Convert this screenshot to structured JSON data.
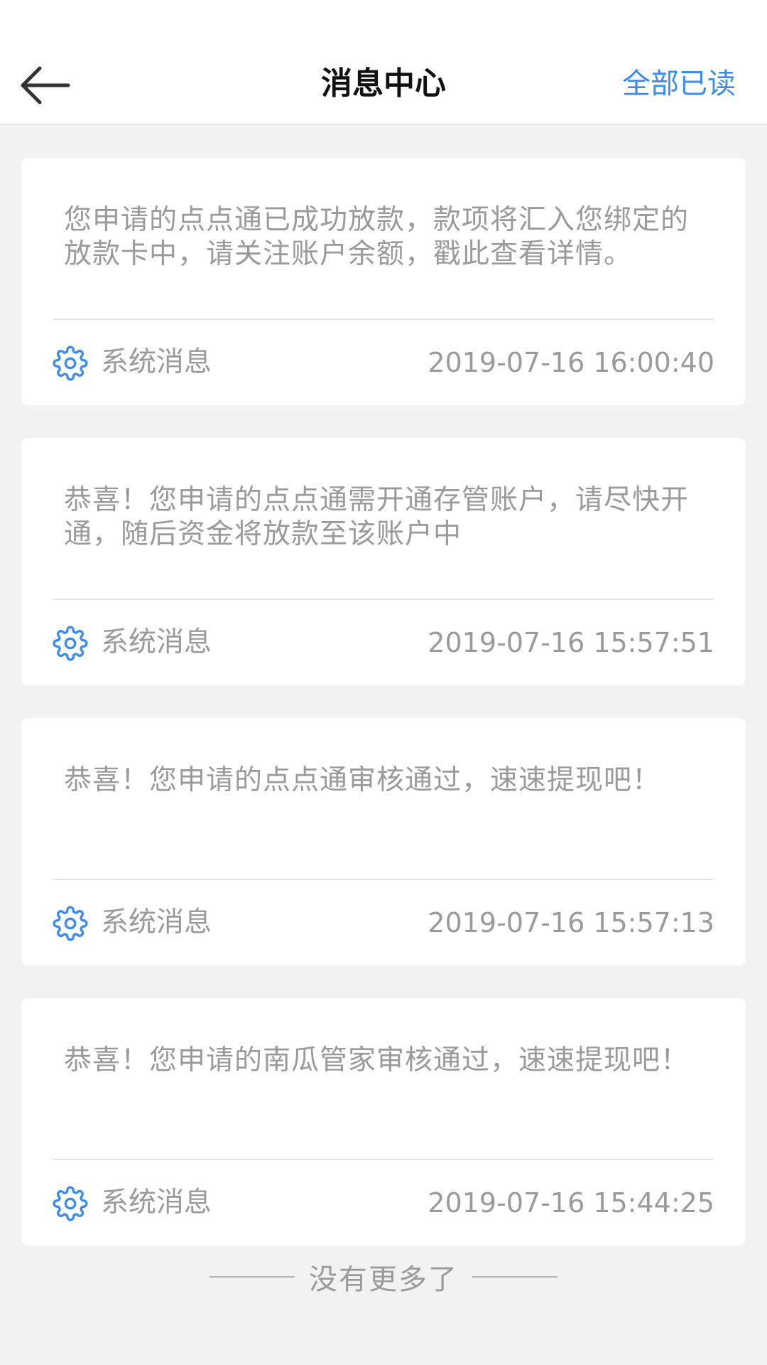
{
  "header": {
    "title": "消息中心",
    "read_all_label": "全部已读"
  },
  "messages": [
    {
      "text": "您申请的点点通已成功放款，款项将汇入您绑定的放款卡中，请关注账户余额，戳此查看详情。",
      "type": "系统消息",
      "time": "2019-07-16 16:00:40"
    },
    {
      "text": "恭喜！您申请的点点通需开通存管账户，请尽快开通，随后资金将放款至该账户中",
      "type": "系统消息",
      "time": "2019-07-16 15:57:51"
    },
    {
      "text": "恭喜！您申请的点点通审核通过，速速提现吧！",
      "type": "系统消息",
      "time": "2019-07-16 15:57:13"
    },
    {
      "text": "恭喜！您申请的南瓜管家审核通过，速速提现吧！",
      "type": "系统消息",
      "time": "2019-07-16 15:44:25"
    }
  ],
  "footer": {
    "end_text": "没有更多了"
  },
  "colors": {
    "accent": "#3d8ce8",
    "background": "#f2f2f2",
    "muted_text": "#9a9a9a"
  },
  "icons": {
    "back": "arrow-left-icon",
    "message_type": "gear-icon"
  }
}
